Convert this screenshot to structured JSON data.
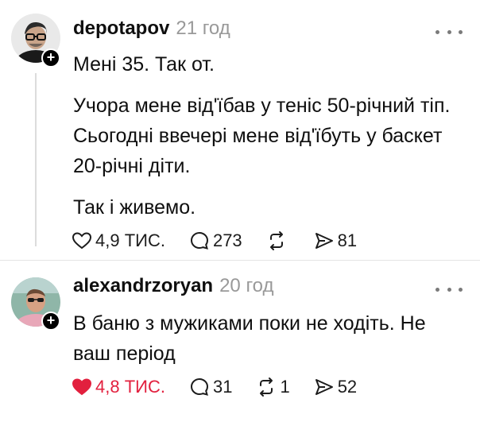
{
  "posts": [
    {
      "username": "depotapov",
      "time": "21 год",
      "follow_symbol": "+",
      "paragraphs": [
        "Мені 35. Так от.",
        "Учора мене від'їбав у теніс 50-річний тіп. Сьогодні ввечері мене від'їбуть у баскет 20-річні діти.",
        "Так і живемо."
      ],
      "likes": "4,9 ТИС.",
      "comments": "273",
      "reposts": "",
      "shares": "81",
      "liked": false
    },
    {
      "username": "alexandrzoryan",
      "time": "20 год",
      "follow_symbol": "+",
      "paragraphs": [
        "В баню з мужиками поки не ходіть. Не ваш період"
      ],
      "likes": "4,8 ТИС.",
      "comments": "31",
      "reposts": "1",
      "shares": "52",
      "liked": true
    }
  ],
  "icons": {
    "like": "heart-icon",
    "comment": "comment-bubble-icon",
    "repost": "repost-icon",
    "share": "share-send-icon",
    "more": "more-dots-icon"
  },
  "colors": {
    "liked": "#e2203e",
    "muted": "#999999",
    "text": "#0f0f0f"
  }
}
